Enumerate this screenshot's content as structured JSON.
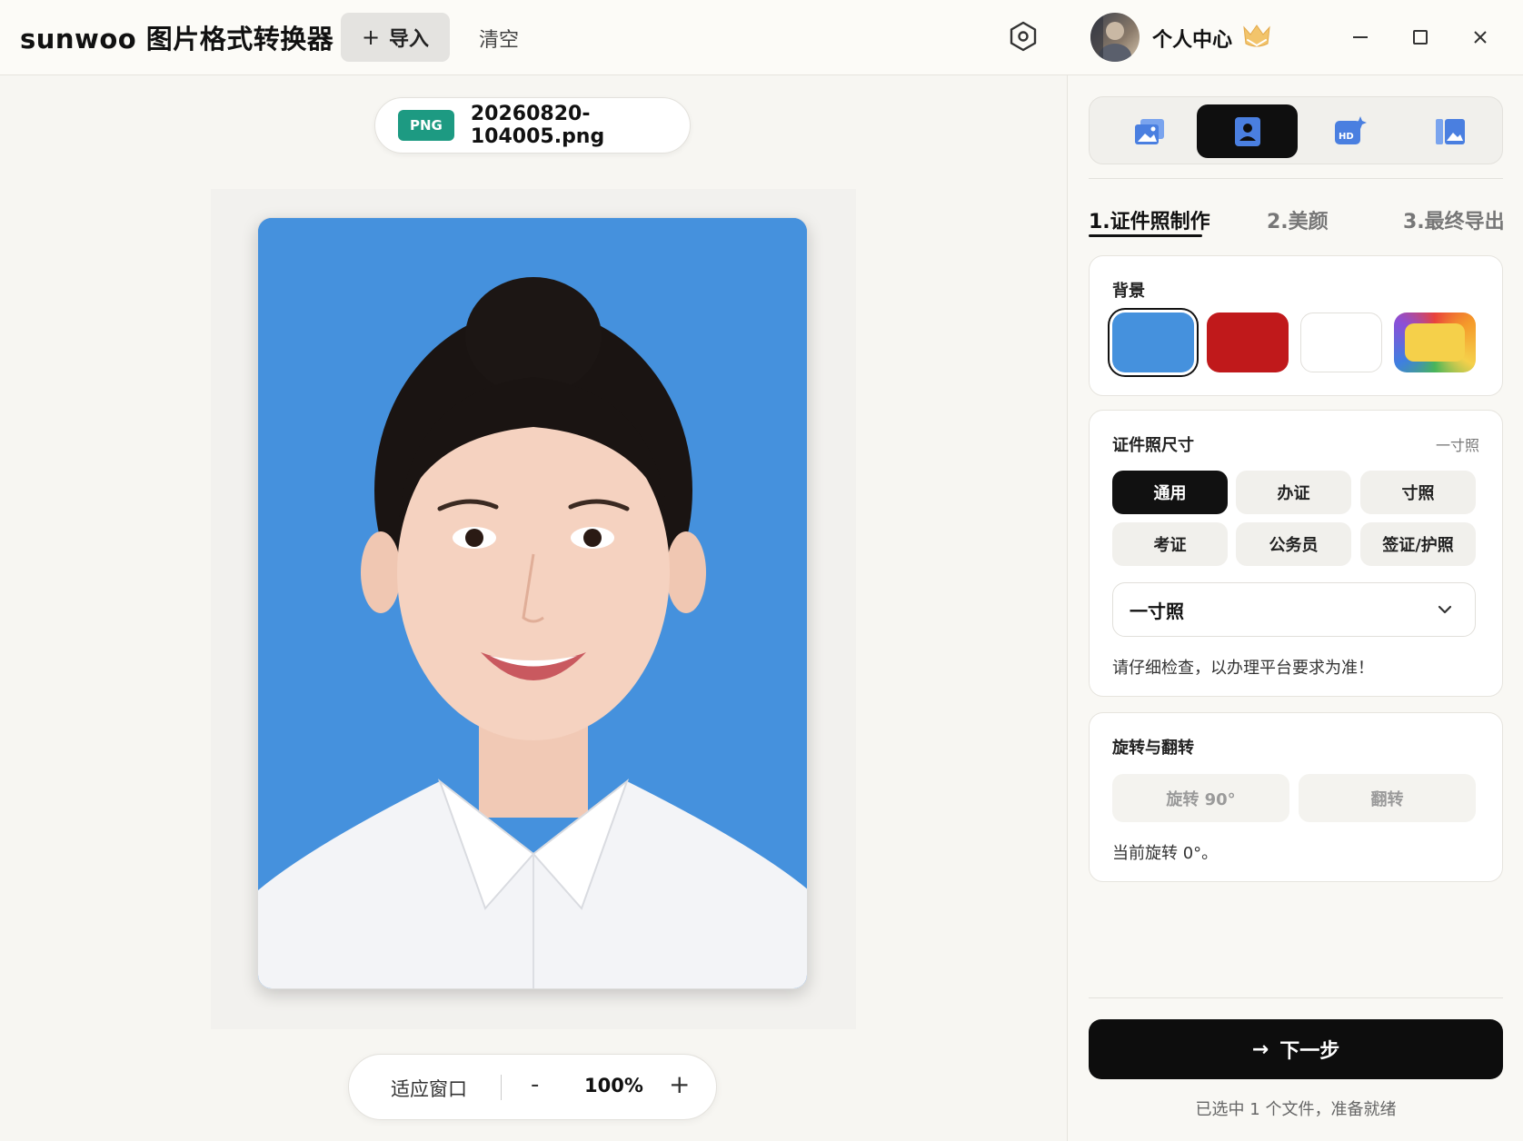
{
  "titlebar": {
    "app_title": "sunwoo 图片格式转换器",
    "import_label": "导入",
    "clear_label": "清空",
    "user_center_label": "个人中心"
  },
  "file": {
    "badge": "PNG",
    "name": "20260820-104005.png"
  },
  "zoom": {
    "fit_label": "适应窗口",
    "minus_label": "-",
    "value": "100%",
    "plus_label": "+"
  },
  "steps": [
    {
      "label": "1.证件照制作"
    },
    {
      "label": "2.美颜"
    },
    {
      "label": "3.最终导出"
    }
  ],
  "background_card": {
    "title": "背景",
    "colors": [
      "#4591dd",
      "#c0191b",
      "#ffffff",
      "#f5d04a"
    ]
  },
  "size_card": {
    "title": "证件照尺寸",
    "note": "一寸照",
    "buttons": [
      {
        "label": "通用"
      },
      {
        "label": "办证"
      },
      {
        "label": "寸照"
      },
      {
        "label": "考证"
      },
      {
        "label": "公务员"
      },
      {
        "label": "签证/护照"
      }
    ],
    "selected_size": "一寸照",
    "hint": "请仔细检查，以办理平台要求为准！"
  },
  "rotate_card": {
    "title": "旋转与翻转",
    "rotate_label": "旋转 90°",
    "flip_label": "翻转",
    "status": "当前旋转 0°。"
  },
  "next_button": {
    "arrow": "→",
    "label": "下一步"
  },
  "status_line": "已选中 1 个文件，准备就绪",
  "colors": {
    "accent_green": "#1d9a82",
    "dark": "#0f0f0f",
    "icon_blue": "#4a7fe0"
  }
}
